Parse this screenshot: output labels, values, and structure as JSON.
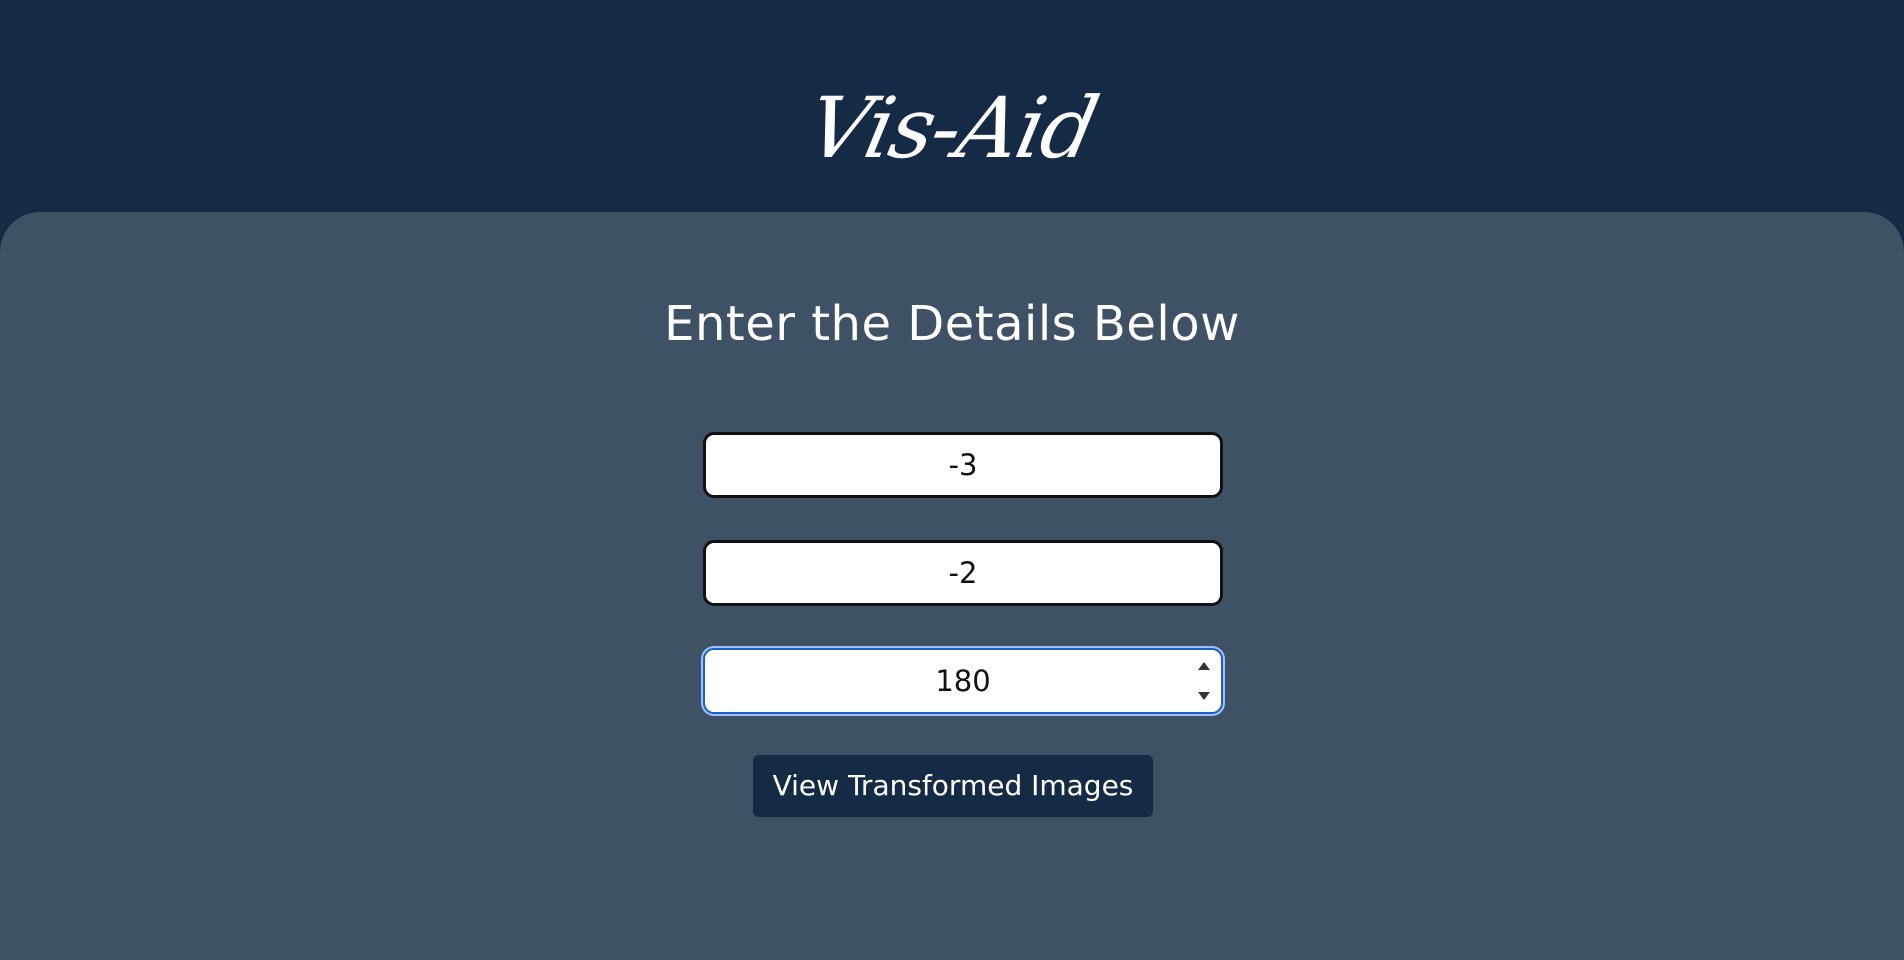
{
  "app": {
    "brand": "Vis-Aid"
  },
  "form": {
    "heading": "Enter the Details Below",
    "fields": [
      {
        "value": "-3"
      },
      {
        "value": "-2"
      },
      {
        "value": "180"
      }
    ],
    "submit_label": "View Transformed Images"
  },
  "colors": {
    "header_bg": "#152a44",
    "panel_bg": "#3f5265",
    "button_bg": "#152a44",
    "text_light": "#ffffff",
    "focus_border": "#1f5fbf"
  },
  "icons": {
    "spinner_up": "triangle-up",
    "spinner_down": "triangle-down"
  }
}
